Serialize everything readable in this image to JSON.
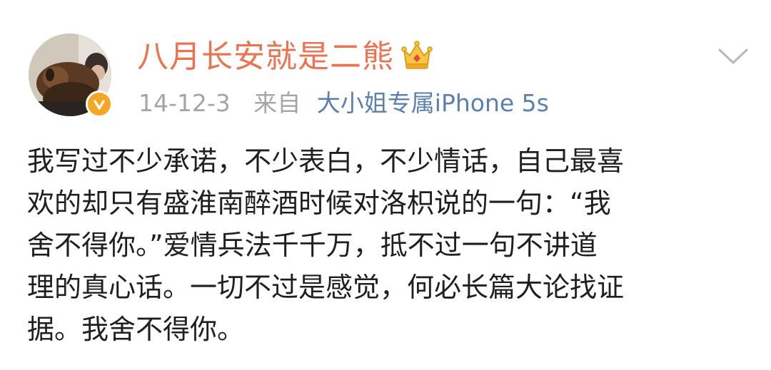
{
  "post": {
    "username": "八月长安就是二熊",
    "date": "14-12-3",
    "source_prefix": "来自",
    "source_device": "大小姐专属iPhone 5s",
    "content_lines": [
      "我写过不少承诺，不少表白，不少情话，自己最喜",
      "欢的却只有盛淮南醉酒时候对洛枳说的一句：“我",
      "舍不得你。”爱情兵法千千万，抵不过一句不讲道",
      "理的真心话。一切不过是感觉，何必长篇大论找证",
      "据。我舍不得你。"
    ]
  },
  "icons": {
    "member_badge": "crown-icon",
    "verified": "verified-badge-icon",
    "menu": "chevron-down-icon"
  },
  "colors": {
    "username": "#eb7350",
    "link": "#5b7fb1",
    "meta_gray": "#a5a5a5",
    "verified_badge": "#f5a623",
    "text": "#1f1f1f"
  }
}
